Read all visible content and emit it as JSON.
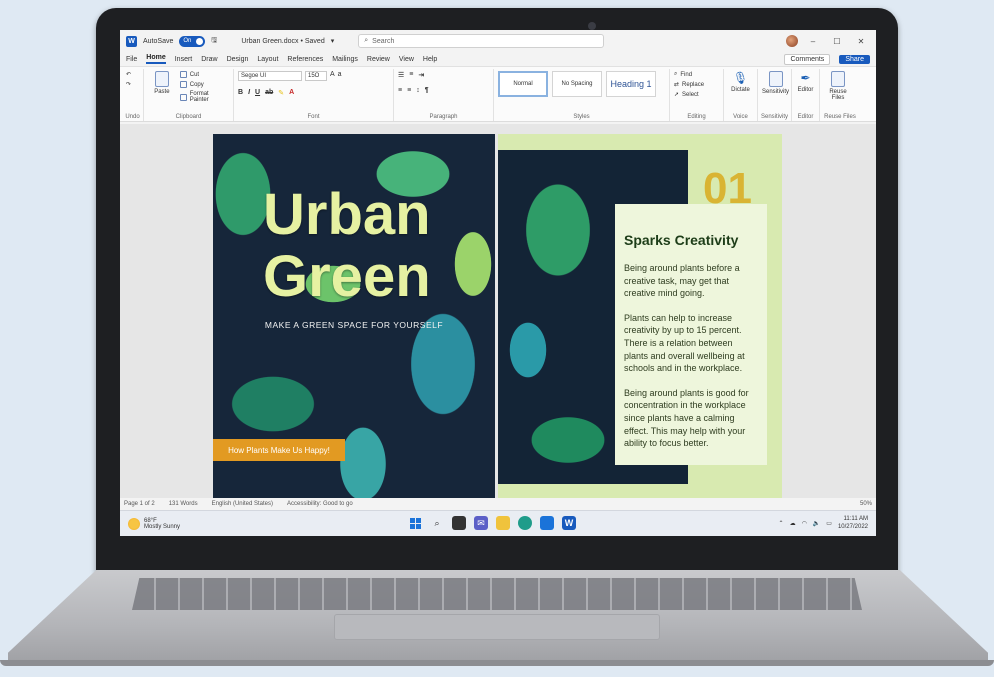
{
  "app": {
    "autosave_label": "AutoSave",
    "autosave_state": "On",
    "doc_title": "Urban Green.docx • Saved",
    "search_placeholder": "Search"
  },
  "menu": {
    "tabs": [
      "File",
      "Home",
      "Insert",
      "Draw",
      "Design",
      "Layout",
      "References",
      "Mailings",
      "Review",
      "View",
      "Help"
    ],
    "active_tab": "Home",
    "comments_label": "Comments",
    "share_label": "Share"
  },
  "ribbon": {
    "undo_group": "Undo",
    "clipboard": {
      "paste": "Paste",
      "cut": "Cut",
      "copy": "Copy",
      "format_painter": "Format Painter",
      "label": "Clipboard"
    },
    "font": {
      "family": "Segoe UI",
      "size": "15O",
      "label": "Font"
    },
    "paragraph_label": "Paragraph",
    "styles": {
      "items": [
        "Normal",
        "No Spacing",
        "Heading 1"
      ],
      "label": "Styles"
    },
    "editing": {
      "find": "Find",
      "replace": "Replace",
      "select": "Select",
      "label": "Editing"
    },
    "voice": {
      "dictate": "Dictate",
      "label": "Voice"
    },
    "sensitivity": {
      "button": "Sensitivity",
      "label": "Sensitivity"
    },
    "editor": {
      "button": "Editor",
      "label": "Editor"
    },
    "reuse": {
      "button": "Reuse Files",
      "label": "Reuse Files"
    }
  },
  "document": {
    "left_page": {
      "title_line1": "Urban",
      "title_line2": "Green",
      "subtitle": "MAKE A GREEN SPACE FOR YOURSELF",
      "cta": "How Plants Make Us Happy!"
    },
    "right_page": {
      "number": "01",
      "heading": "Sparks Creativity",
      "paragraphs": [
        "Being around plants before a creative task, may get that creative mind going.",
        "Plants can help to increase creativity by up to 15 percent. There is a relation between plants and overall wellbeing at schools and in the workplace.",
        "Being around plants is good for concentration in the workplace since plants have a calming effect. This may help with your ability to focus better."
      ]
    }
  },
  "status": {
    "page": "Page 1 of 2",
    "words": "131 Words",
    "language": "English (United States)",
    "accessibility": "Accessibility: Good to go",
    "zoom": "50%"
  },
  "taskbar": {
    "temp": "68°F",
    "weather": "Mostly Sunny",
    "time": "11:11 AM",
    "date": "10/27/2022"
  }
}
